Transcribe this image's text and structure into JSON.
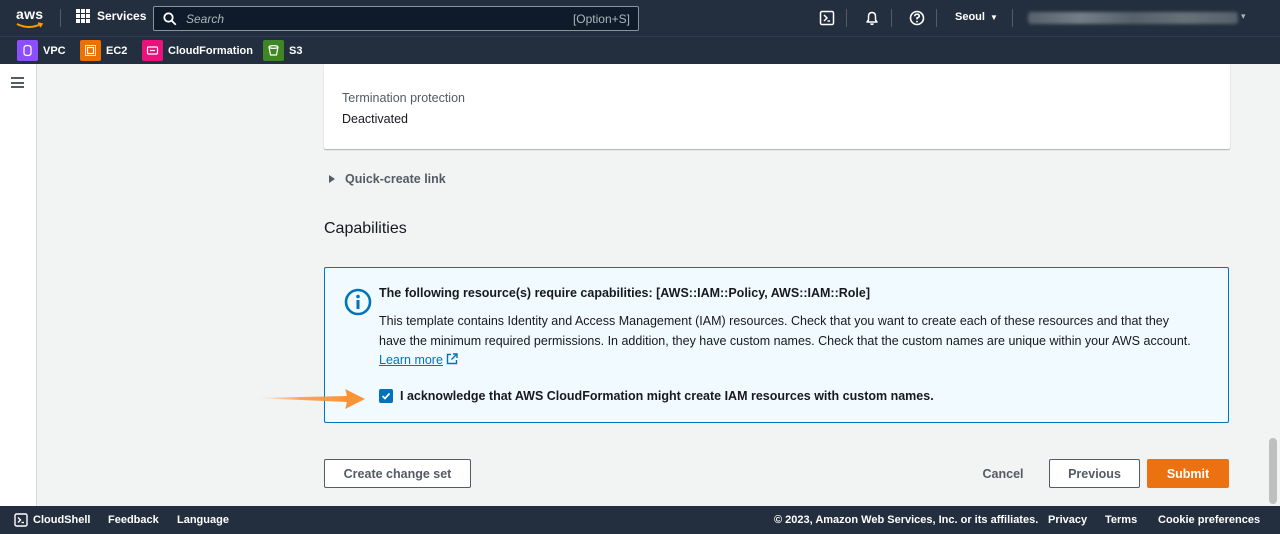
{
  "topnav": {
    "logo_text": "aws",
    "services_label": "Services",
    "search_placeholder": "Search",
    "search_shortcut": "[Option+S]",
    "region_label": "Seoul",
    "icons": [
      "cloudshell-icon",
      "bell-icon",
      "help-icon"
    ]
  },
  "favorites": [
    {
      "label": "VPC",
      "color": "#8c4fff",
      "icon": "vpc-icon"
    },
    {
      "label": "EC2",
      "color": "#ed7100",
      "icon": "ec2-icon"
    },
    {
      "label": "CloudFormation",
      "color": "#e7157b",
      "icon": "cloudformation-icon"
    },
    {
      "label": "S3",
      "color": "#3f8624",
      "icon": "s3-icon"
    }
  ],
  "details": {
    "termination_label": "Termination protection",
    "termination_value": "Deactivated"
  },
  "quick_create_label": "Quick-create link",
  "capabilities": {
    "heading": "Capabilities",
    "info_title": "The following resource(s) require capabilities: [AWS::IAM::Policy, AWS::IAM::Role]",
    "info_body": "This template contains Identity and Access Management (IAM) resources. Check that you want to create each of these resources and that they have the minimum required permissions. In addition, they have custom names. Check that the custom names are unique within your AWS account.",
    "learn_more": "Learn more",
    "ack_label": "I acknowledge that AWS CloudFormation might create IAM resources with custom names.",
    "ack_checked": true
  },
  "actions": {
    "create_change_set": "Create change set",
    "cancel": "Cancel",
    "previous": "Previous",
    "submit": "Submit"
  },
  "footer": {
    "cloudshell": "CloudShell",
    "feedback": "Feedback",
    "language": "Language",
    "copyright": "© 2023, Amazon Web Services, Inc. or its affiliates.",
    "privacy": "Privacy",
    "terms": "Terms",
    "cookie": "Cookie preferences"
  },
  "colors": {
    "nav_bg": "#232f3e",
    "primary": "#ec7211",
    "link": "#0073bb",
    "info_bg": "#f1faff",
    "annotation_arrow": "#f7943a"
  }
}
